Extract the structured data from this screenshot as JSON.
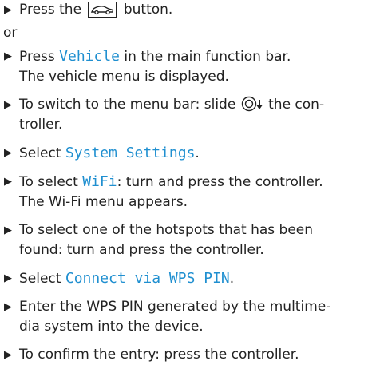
{
  "marker": "▶",
  "steps": [
    {
      "pre": "Press the",
      "post": "button.",
      "icon": "car-button-icon"
    },
    {
      "or": "or"
    },
    {
      "pre": "Press",
      "hl": "Vehicle",
      "post": "in the main function bar.",
      "line2": "The vehicle menu is displayed."
    },
    {
      "pre": "To switch to the menu bar: slide",
      "icon": "controller-slide-down-icon",
      "post": "the con-",
      "line2": "troller."
    },
    {
      "pre": "Select",
      "hl": "System Settings",
      "post": "."
    },
    {
      "pre": "To select",
      "hl": "WiFi",
      "post": ": turn and press the controller.",
      "line2": "The Wi-Fi menu appears."
    },
    {
      "line1": "To select one of the hotspots that has been",
      "line2": "found: turn and press the controller."
    },
    {
      "pre": "Select",
      "hl": "Connect via WPS PIN",
      "post": "."
    },
    {
      "line1": "Enter the WPS PIN generated by the multime-",
      "line2": "dia system into the device."
    },
    {
      "line1": "To confirm the entry: press the controller."
    }
  ]
}
